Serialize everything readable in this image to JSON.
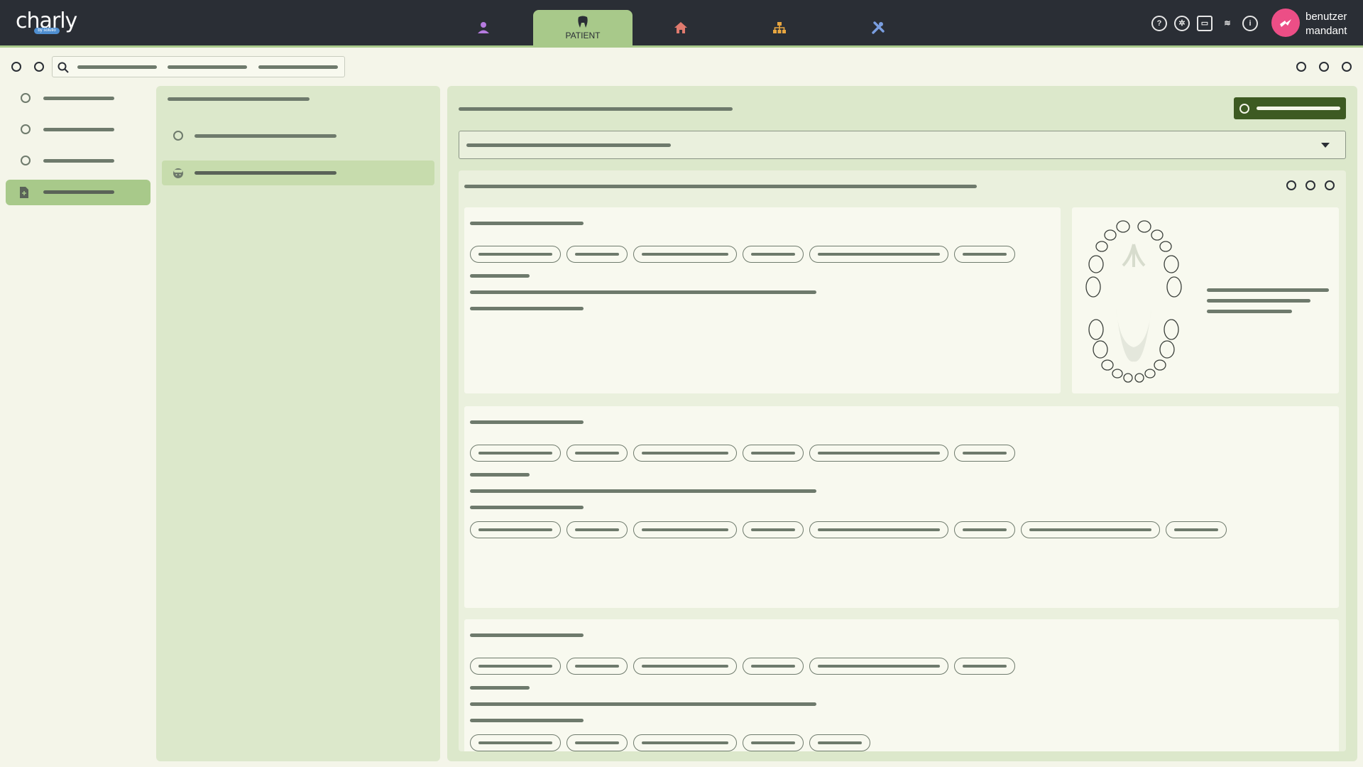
{
  "app": {
    "logo_text": "charly",
    "logo_badge": "by solutio"
  },
  "nav": {
    "tabs": [
      {
        "id": "person",
        "icon": "person-icon",
        "color": "#b67be0"
      },
      {
        "id": "patient",
        "label": "PATIENT",
        "icon": "tooth-icon",
        "active": true
      },
      {
        "id": "home",
        "icon": "home-icon",
        "color": "#e07a6e"
      },
      {
        "id": "org",
        "icon": "org-chart-icon",
        "color": "#e8a640"
      },
      {
        "id": "tools",
        "icon": "tools-icon",
        "color": "#7a9ee0"
      }
    ]
  },
  "toolbar_icons": [
    "help-icon",
    "settings-icon",
    "card-icon",
    "handshake-icon",
    "info-icon"
  ],
  "user": {
    "line1": "benutzer",
    "line2": "mandant",
    "avatar_color": "#ec4e86"
  },
  "colors": {
    "topbar": "#2a2e35",
    "accent": "#a8c98a",
    "panel": "#dce8cb",
    "primary_button": "#3d5a22",
    "avatar": "#ec4e86"
  }
}
